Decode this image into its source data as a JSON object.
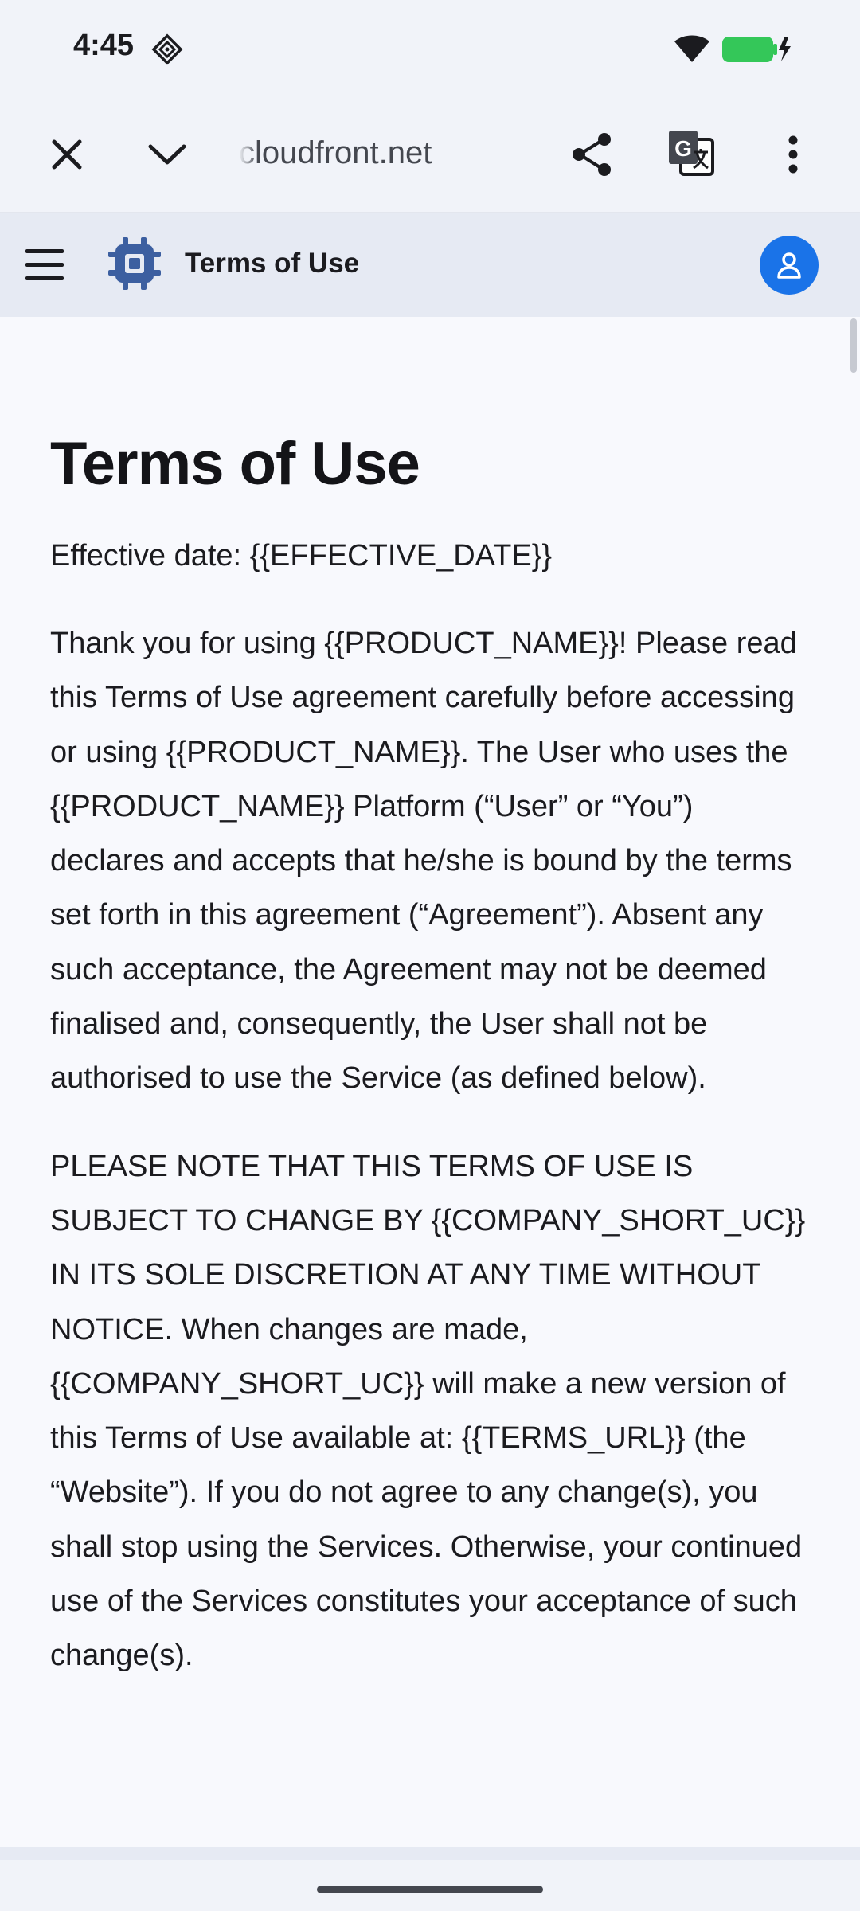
{
  "status_bar": {
    "time": "4:45"
  },
  "browser": {
    "url": "cloudfront.net",
    "icons": [
      "close-icon",
      "chevron-down-icon",
      "share-icon",
      "translate-icon",
      "more-vert-icon"
    ]
  },
  "app_header": {
    "title": "Terms of Use",
    "icons": [
      "menu-icon",
      "chip-logo-icon",
      "account-icon"
    ],
    "accent_color": "#1a73e8",
    "logo_color": "#3c5fa0"
  },
  "page": {
    "title": "Terms of Use",
    "effective": "Effective date: {{EFFECTIVE_DATE}}",
    "paragraphs": [
      "Thank you for using {{PRODUCT_NAME}}! Please read this Terms of Use agreement carefully before accessing or using {{PRODUCT_NAME}}. The User who uses the {{PRODUCT_NAME}} Platform (“User” or “You”) declares and accepts that he/she is bound by the terms set forth in this agreement (“Agreement”). Absent any such acceptance, the Agreement may not be deemed finalised and, consequently, the User shall not be authorised to use the Service (as defined below).",
      "PLEASE NOTE THAT THIS TERMS OF USE IS SUBJECT TO CHANGE BY {{COMPANY_SHORT_UC}} IN ITS SOLE DISCRETION AT ANY TIME WITHOUT NOTICE. When changes are made, {{COMPANY_SHORT_UC}} will make a new version of this Terms of Use available at: {{TERMS_URL}} (the “Website”). If you do not agree to any change(s), you shall stop using the Services. Otherwise, your continued use of the Services constitutes your acceptance of such change(s)."
    ]
  }
}
